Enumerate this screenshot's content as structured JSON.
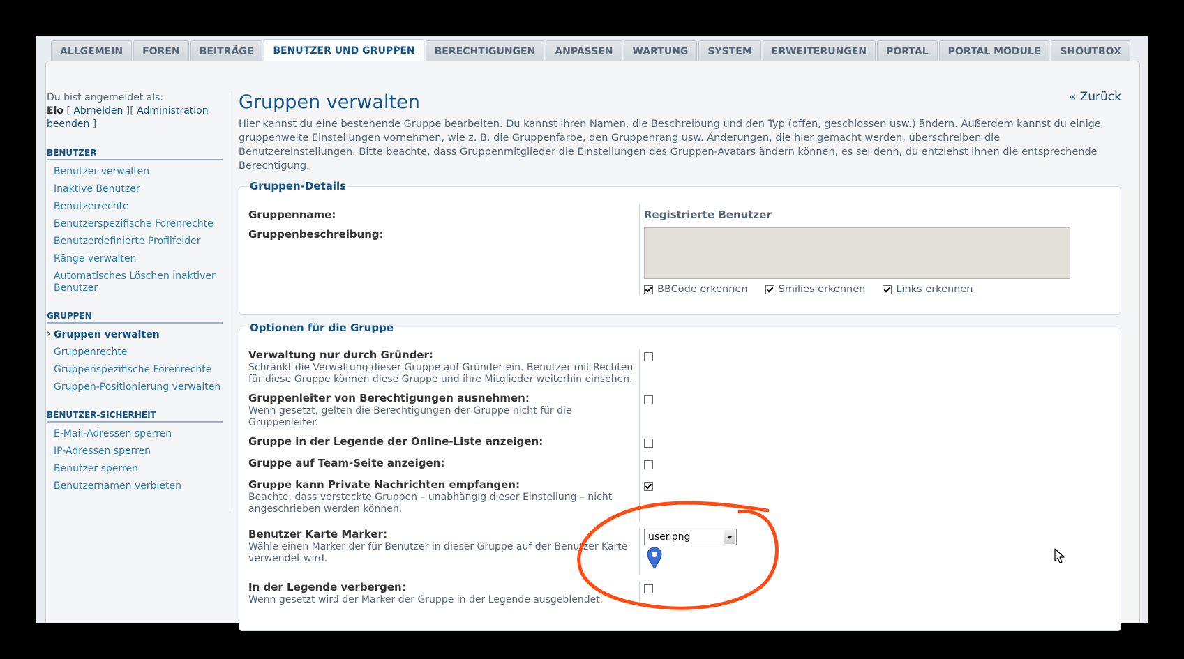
{
  "tabs": [
    {
      "label": "ALLGEMEIN",
      "active": false
    },
    {
      "label": "FOREN",
      "active": false
    },
    {
      "label": "BEITRÄGE",
      "active": false
    },
    {
      "label": "BENUTZER UND GRUPPEN",
      "active": true
    },
    {
      "label": "BERECHTIGUNGEN",
      "active": false
    },
    {
      "label": "ANPASSEN",
      "active": false
    },
    {
      "label": "WARTUNG",
      "active": false
    },
    {
      "label": "SYSTEM",
      "active": false
    },
    {
      "label": "ERWEITERUNGEN",
      "active": false
    },
    {
      "label": "PORTAL",
      "active": false
    },
    {
      "label": "PORTAL MODULE",
      "active": false
    },
    {
      "label": "SHOUTBOX",
      "active": false
    }
  ],
  "sidebar": {
    "login_prefix": "Du bist angemeldet als:",
    "username": "Elo",
    "logout_label": "Abmelden",
    "end_admin_label": "Administration beenden",
    "sections": [
      {
        "title": "BENUTZER",
        "items": [
          {
            "label": "Benutzer verwalten"
          },
          {
            "label": "Inaktive Benutzer"
          },
          {
            "label": "Benutzerrechte"
          },
          {
            "label": "Benutzerspezifische Forenrechte"
          },
          {
            "label": "Benutzerdefinierte Profilfelder"
          },
          {
            "label": "Ränge verwalten"
          },
          {
            "label": "Automatisches Löschen inaktiver Benutzer"
          }
        ]
      },
      {
        "title": "GRUPPEN",
        "items": [
          {
            "label": "Gruppen verwalten",
            "current": true
          },
          {
            "label": "Gruppenrechte"
          },
          {
            "label": "Gruppenspezifische Forenrechte"
          },
          {
            "label": "Gruppen-Positionierung verwalten"
          }
        ]
      },
      {
        "title": "BENUTZER-SICHERHEIT",
        "items": [
          {
            "label": "E-Mail-Adressen sperren"
          },
          {
            "label": "IP-Adressen sperren"
          },
          {
            "label": "Benutzer sperren"
          },
          {
            "label": "Benutzernamen verbieten"
          }
        ]
      }
    ]
  },
  "main": {
    "title": "Gruppen verwalten",
    "back_label": "« Zurück",
    "intro": "Hier kannst du eine bestehende Gruppe bearbeiten. Du kannst ihren Namen, die Beschreibung und den Typ (offen, geschlossen usw.) ändern. Außerdem kannst du einige gruppenweite Einstellungen vornehmen, wie z. B. die Gruppenfarbe, den Gruppenrang usw. Änderungen, die hier gemacht werden, überschreiben die Benutzereinstellungen. Bitte beachte, dass Gruppenmitglieder die Einstellungen des Gruppen-Avatars ändern können, es sei denn, du entziehst ihnen die entsprechende Berechtigung.",
    "details": {
      "legend": "Gruppen-Details",
      "name_label": "Gruppenname:",
      "name_value": "Registrierte Benutzer",
      "desc_label": "Gruppenbeschreibung:",
      "desc_value": "",
      "bbcode_label": "BBCode erkennen",
      "bbcode_checked": true,
      "smilies_label": "Smilies erkennen",
      "smilies_checked": true,
      "links_label": "Links erkennen",
      "links_checked": true
    },
    "options": {
      "legend": "Optionen für die Gruppe",
      "rows": [
        {
          "title": "Verwaltung nur durch Gründer:",
          "desc": "Schränkt die Verwaltung dieser Gruppe auf Gründer ein. Benutzer mit Rechten für diese Gruppe können diese Gruppe und ihre Mitglieder weiterhin einsehen.",
          "checked": false
        },
        {
          "title": "Gruppenleiter von Berechtigungen ausnehmen:",
          "desc": "Wenn gesetzt, gelten die Berechtigungen der Gruppe nicht für die Gruppenleiter.",
          "checked": false
        },
        {
          "title": "Gruppe in der Legende der Online-Liste anzeigen:",
          "desc": "",
          "checked": false
        },
        {
          "title": "Gruppe auf Team-Seite anzeigen:",
          "desc": "",
          "checked": false
        },
        {
          "title": "Gruppe kann Private Nachrichten empfangen:",
          "desc": "Beachte, dass versteckte Gruppen – unabhängig dieser Einstellung – nicht angeschrieben werden können.",
          "checked": true
        }
      ],
      "marker": {
        "title": "Benutzer Karte Marker:",
        "desc": "Wähle einen Marker der für Benutzer in dieser Gruppe auf der Benutzer Karte verwendet wird.",
        "selected": "user.png",
        "pin_color": "#3b6fd6"
      },
      "hide_legend": {
        "title": "In der Legende verbergen:",
        "desc": "Wenn gesetzt wird der Marker der Gruppe in der Legende ausgeblendet.",
        "checked": false
      }
    }
  },
  "colors": {
    "accent": "#105289",
    "link": "#2b7bb5",
    "annotation": "#ff4a12"
  }
}
